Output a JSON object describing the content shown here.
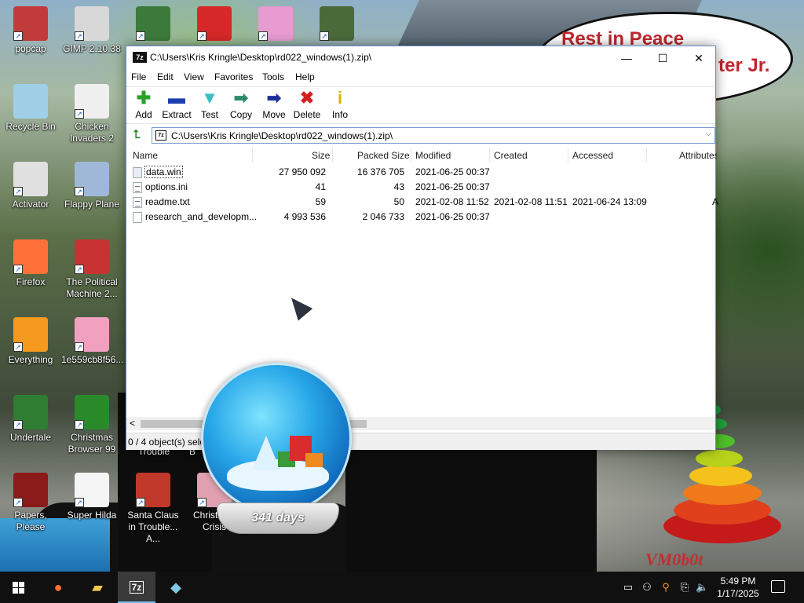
{
  "desktop": {
    "icons": [
      {
        "label": "popcap",
        "icon": "popcap-icon",
        "color": "#c23b3b"
      },
      {
        "label": "GIMP 2.10.38",
        "icon": "gimp-icon",
        "color": "#d8d8d8"
      },
      {
        "label": "",
        "icon": "pixel-character-icon",
        "color": "#3b7a3b"
      },
      {
        "label": "",
        "icon": "mcdonalds-icon",
        "color": "#d62828"
      },
      {
        "label": "",
        "icon": "pig-icon",
        "color": "#e79bd0"
      },
      {
        "label": "",
        "icon": "game-icon",
        "color": "#4a6a3a"
      },
      {
        "label": "Recycle Bin",
        "icon": "recycle-bin-icon",
        "color": "#9fd0e8"
      },
      {
        "label": "Chicken Invaders 2",
        "icon": "chicken-icon",
        "color": "#f0f0f0"
      },
      {
        "label": "Activator",
        "icon": "activator-icon",
        "color": "#e0e0e0"
      },
      {
        "label": "Flappy Plane",
        "icon": "plane-icon",
        "color": "#9fb8d8"
      },
      {
        "label": "Firefox",
        "icon": "firefox-icon",
        "color": "#ff7139"
      },
      {
        "label": "The Political Machine 2...",
        "icon": "political-machine-icon",
        "color": "#c83232"
      },
      {
        "label": "Everything",
        "icon": "search-icon",
        "color": "#f39a1f"
      },
      {
        "label": "1e559cb8f56...",
        "icon": "image-file-icon",
        "color": "#f2a0c0"
      },
      {
        "label": "Undertale",
        "icon": "undertale-icon",
        "color": "#2e7d32"
      },
      {
        "label": "Christmas Browser 99",
        "icon": "christmas-tree-icon",
        "color": "#2a8a2a"
      },
      {
        "label": "Papers, Please",
        "icon": "papers-please-icon",
        "color": "#8b1a1a"
      },
      {
        "label": "Super Hilda",
        "icon": "hilda-icon",
        "color": "#f5f5f5"
      },
      {
        "label": "Santa Claus in Trouble... A...",
        "icon": "santa-icon",
        "color": "#c0392b"
      },
      {
        "label": "Christmas Crisis",
        "icon": "christmas-crisis-icon",
        "color": "#e0a0b0"
      }
    ],
    "partial_labels": {
      "trouble": "Trouble",
      "b": "B"
    },
    "bubble_line1": "Rest in Peace",
    "bubble_line2": "ter Jr.",
    "watermark": "VM0b0t",
    "snowglobe_days": "341 days"
  },
  "window": {
    "title": "C:\\Users\\Kris Kringle\\Desktop\\rd022_windows(1).zip\\",
    "app_icon_text": "7z",
    "controls": {
      "minimize": "—",
      "maximize": "☐",
      "close": "✕"
    },
    "menu": [
      "File",
      "Edit",
      "View",
      "Favorites",
      "Tools",
      "Help"
    ],
    "toolbar": [
      {
        "label": "Add",
        "glyph": "✚",
        "color": "#27a227",
        "icon": "add-icon"
      },
      {
        "label": "Extract",
        "glyph": "▬",
        "color": "#1c3fb0",
        "icon": "extract-icon"
      },
      {
        "label": "Test",
        "glyph": "▼",
        "color": "#3bbdc4",
        "icon": "test-icon"
      },
      {
        "label": "Copy",
        "glyph": "➡",
        "color": "#2c8a6a",
        "icon": "copy-icon"
      },
      {
        "label": "Move",
        "glyph": "➡",
        "color": "#1a2f9c",
        "icon": "move-icon"
      },
      {
        "label": "Delete",
        "glyph": "✖",
        "color": "#d42020",
        "icon": "delete-icon"
      },
      {
        "label": "Info",
        "glyph": "i",
        "color": "#d6b300",
        "icon": "info-icon"
      }
    ],
    "address": {
      "path": "C:\\Users\\Kris Kringle\\Desktop\\rd022_windows(1).zip\\",
      "up_glyph": "⮤",
      "icon_text": "7z",
      "dropdown": "⌵"
    },
    "columns": [
      "Name",
      "Size",
      "Packed Size",
      "Modified",
      "Created",
      "Accessed",
      "Attributes"
    ],
    "files": [
      {
        "name": "data.win",
        "size": "27 950 092",
        "packed": "16 376 705",
        "modified": "2021-06-25 00:37",
        "created": "",
        "accessed": "",
        "attributes": "",
        "type": "bin"
      },
      {
        "name": "options.ini",
        "size": "41",
        "packed": "43",
        "modified": "2021-06-25 00:37",
        "created": "",
        "accessed": "",
        "attributes": "",
        "type": "doc"
      },
      {
        "name": "readme.txt",
        "size": "59",
        "packed": "50",
        "modified": "2021-02-08 11:52",
        "created": "2021-02-08 11:51",
        "accessed": "2021-06-24 13:09",
        "attributes": "A",
        "type": "doc"
      },
      {
        "name": "research_and_developm...",
        "size": "4 993 536",
        "packed": "2 046 733",
        "modified": "2021-06-25 00:37",
        "created": "",
        "accessed": "",
        "attributes": "",
        "type": "exe"
      }
    ],
    "scroll_left": "<",
    "status": "0 / 4 object(s) sele"
  },
  "taskbar": {
    "items": [
      {
        "name": "start",
        "glyph": ""
      },
      {
        "name": "firefox",
        "glyph": "●",
        "color": "#ff7139"
      },
      {
        "name": "file-explorer",
        "glyph": "▰",
        "color": "#f2c84b"
      },
      {
        "name": "7zip",
        "glyph": "7z",
        "color": "#ffffff"
      },
      {
        "name": "snowglobe",
        "glyph": "◆",
        "color": "#7ec8e3"
      }
    ],
    "tray": [
      "▭",
      "⚇",
      "⚲",
      "⎘",
      "🔈"
    ],
    "time": "5:49 PM",
    "date": "1/17/2025"
  }
}
